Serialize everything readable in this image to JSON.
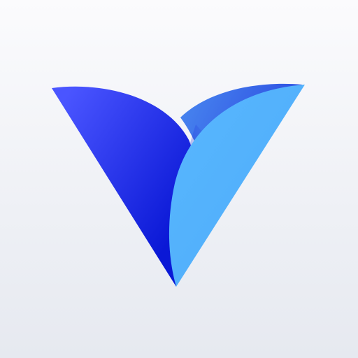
{
  "icon": {
    "name": "v-leaf-logo",
    "background_colors": [
      "#fbfbfd",
      "#e6e9f0"
    ],
    "colors": {
      "left_leaf_light": "#4a55ff",
      "left_leaf_dark": "#0a18d6",
      "back_leaf_light": "#4a8af0",
      "back_leaf_dark": "#2a48e0",
      "front_leaf": "#54b2fc"
    }
  }
}
